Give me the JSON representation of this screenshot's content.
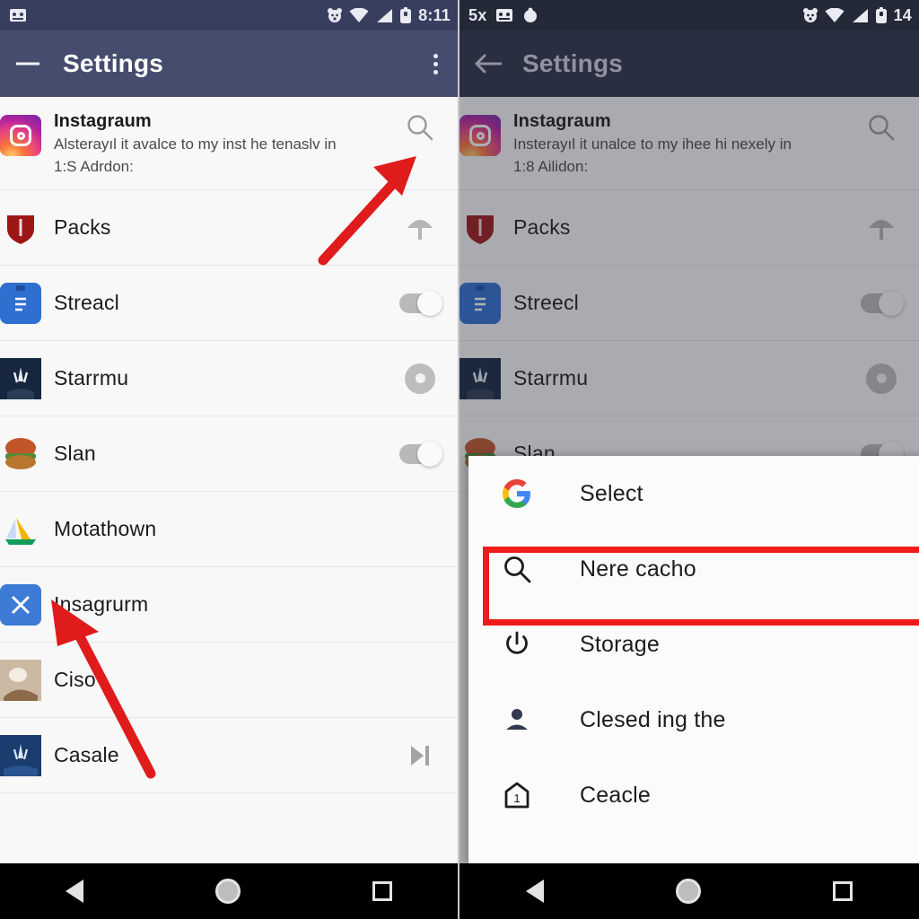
{
  "left_panel": {
    "status_bar": {
      "icons": [
        "photo-icon",
        "bear-icon",
        "wifi-icon",
        "signal-icon",
        "battery-icon"
      ],
      "time": "8:11"
    },
    "app_bar": {
      "back_icon": "back-arrow-icon",
      "title": "Settings",
      "overflow_icon": "overflow-menu-icon"
    },
    "list": [
      {
        "icon": "instagram-icon",
        "title": "Instagraum",
        "subtitle_line1": "Alsterayıl it avalce to my inst he tenaslv in",
        "subtitle_line2": "1:S Adrdon:",
        "accessory": "search-icon"
      },
      {
        "icon": "shield-icon",
        "title": "Packs",
        "accessory": "mushroom-icon"
      },
      {
        "icon": "docs-icon",
        "title": "Streacl",
        "accessory": "toggle-switch-on"
      },
      {
        "icon": "dark-app-icon",
        "title": "Starrmu",
        "accessory": "radio-circle"
      },
      {
        "icon": "burger-icon",
        "title": "Slan",
        "accessory": "toggle-switch-on"
      },
      {
        "icon": "drive-icon",
        "title": "Motathown",
        "accessory": ""
      },
      {
        "icon": "blue-x-icon",
        "title": "Insagrurm",
        "accessory": ""
      },
      {
        "icon": "photo-app-icon",
        "title": "Ciso",
        "accessory": ""
      },
      {
        "icon": "blue-night-icon",
        "title": "Casale",
        "accessory": "skip-next-icon"
      }
    ],
    "nav_bar": {
      "back": "nav-back-icon",
      "home": "nav-home-icon",
      "recents": "nav-recents-icon"
    }
  },
  "right_panel": {
    "status_bar": {
      "left_text": "5x",
      "icons": [
        "photo-icon",
        "blob-icon",
        "bear-icon",
        "wifi-icon",
        "signal-icon",
        "battery-icon"
      ],
      "time": "14"
    },
    "app_bar": {
      "back_icon": "back-arrow-icon",
      "title": "Settings"
    },
    "list": [
      {
        "icon": "instagram-icon",
        "title": "Instagraum",
        "subtitle_line1": "Insterayıl it unalce to my ihee hi nexely in",
        "subtitle_line2": "1:8 Ailidon:",
        "accessory": "search-icon"
      },
      {
        "icon": "shield-icon",
        "title": "Packs",
        "accessory": "mushroom-icon"
      },
      {
        "icon": "docs-icon",
        "title": "Streecl",
        "accessory": "toggle-switch-on"
      },
      {
        "icon": "dark-app-icon",
        "title": "Starrmu",
        "accessory": "radio-circle"
      },
      {
        "icon": "burger-icon",
        "title": "Slan",
        "accessory": "toggle-switch-on"
      }
    ],
    "menu": {
      "items": [
        {
          "icon": "google-g-icon",
          "label": "Select"
        },
        {
          "icon": "search-icon",
          "label": "Nere cacho"
        },
        {
          "icon": "power-icon",
          "label": "Storage"
        },
        {
          "icon": "person-icon",
          "label": "Clesed ing the"
        },
        {
          "icon": "home-badge-icon",
          "label": "Ceacle"
        }
      ],
      "highlighted_index": 1,
      "highlight_color": "#ef1b1b"
    },
    "nav_bar": {
      "back": "nav-back-icon",
      "home": "nav-home-icon",
      "recents": "nav-recents-icon"
    }
  },
  "annotations": {
    "arrow_color": "#e01b1b",
    "arrow_1": "points-to-search-icon",
    "arrow_2": "points-to-insagrurm-row"
  }
}
